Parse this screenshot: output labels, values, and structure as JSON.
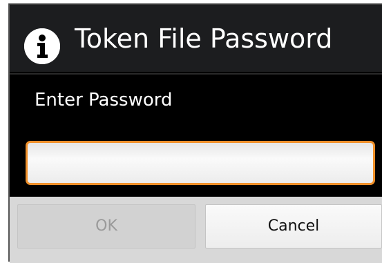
{
  "dialog": {
    "title": "Token File Password",
    "title_icon": "info-icon",
    "prompt": "Enter Password",
    "password": {
      "value": "",
      "placeholder": ""
    },
    "buttons": {
      "ok_label": "OK",
      "ok_enabled": false,
      "cancel_label": "Cancel"
    }
  },
  "colors": {
    "dialog_background": "#000000",
    "title_bar": "#1c1d1f",
    "input_focus_border": "#f0902a",
    "button_bar": "#d8d8d8",
    "disabled_text": "#9a9a9a"
  }
}
